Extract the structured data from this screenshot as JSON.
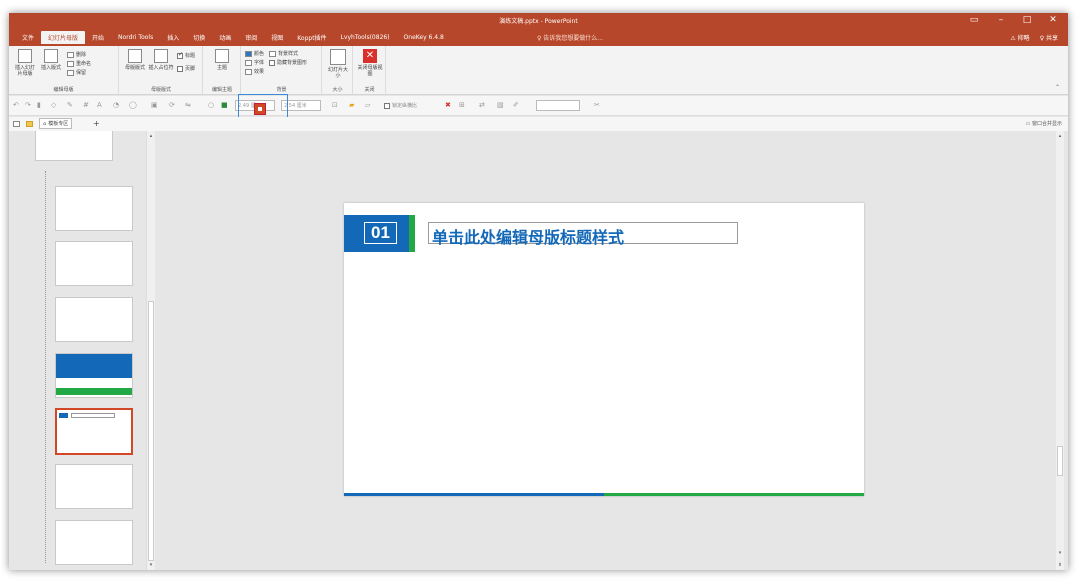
{
  "window": {
    "title": "演练文稿.pptx - PowerPoint",
    "controls": [
      "▭",
      "–",
      "□",
      "✕"
    ]
  },
  "tabs": [
    {
      "label": "文件",
      "active": false
    },
    {
      "label": "幻灯片母版",
      "active": true
    },
    {
      "label": "开始",
      "active": false
    },
    {
      "label": "Nordri Tools",
      "active": false
    },
    {
      "label": "插入",
      "active": false
    },
    {
      "label": "切换",
      "active": false
    },
    {
      "label": "动画",
      "active": false
    },
    {
      "label": "审阅",
      "active": false
    },
    {
      "label": "视图",
      "active": false
    },
    {
      "label": "Koppt插件",
      "active": false
    },
    {
      "label": "LvyhTools(0826)",
      "active": false
    },
    {
      "label": "OneKey 6.4.8",
      "active": false
    }
  ],
  "tell_me": "♀ 告诉我您想要做什么...",
  "right_buttons": {
    "warning": "⚠ 抑略",
    "share": "♀ 共享"
  },
  "ribbon": {
    "edit_master": {
      "label": "编辑母版",
      "insert_slide_master": "插入幻灯片母版",
      "insert_layout": "插入版式",
      "delete": "删除",
      "rename": "重命名",
      "preserve": "保留"
    },
    "master_layout": {
      "label": "母版版式",
      "master_layout_btn": "母版版式",
      "insert_placeholder": "插入占位符",
      "title_check": "标题",
      "footer_check": "页脚"
    },
    "edit_theme": {
      "label": "编辑主题",
      "themes": "主题"
    },
    "background": {
      "label": "背景",
      "colors": "颜色",
      "fonts": "字体",
      "effects": "效果",
      "bg_styles": "背景样式",
      "hide_bg": "隐藏背景图形"
    },
    "size": {
      "label": "大小",
      "slide_size": "幻灯片大小"
    },
    "close": {
      "label": "关闭",
      "close_master": "关闭母版视图"
    }
  },
  "quick_toolbar": {
    "height_value": "2.49 厘米",
    "width_value": "2.54 厘米",
    "lock_ratio": "锁定纵横比"
  },
  "side_tabs": {
    "template_zone": "模板专区",
    "add": "+",
    "merge_display": "窗口合并显示"
  },
  "slide": {
    "number": "01",
    "title": "单击此处编辑母版标题样式"
  },
  "colors": {
    "accent_red": "#b7472a",
    "slide_blue": "#1369b7",
    "slide_green": "#22a844"
  }
}
